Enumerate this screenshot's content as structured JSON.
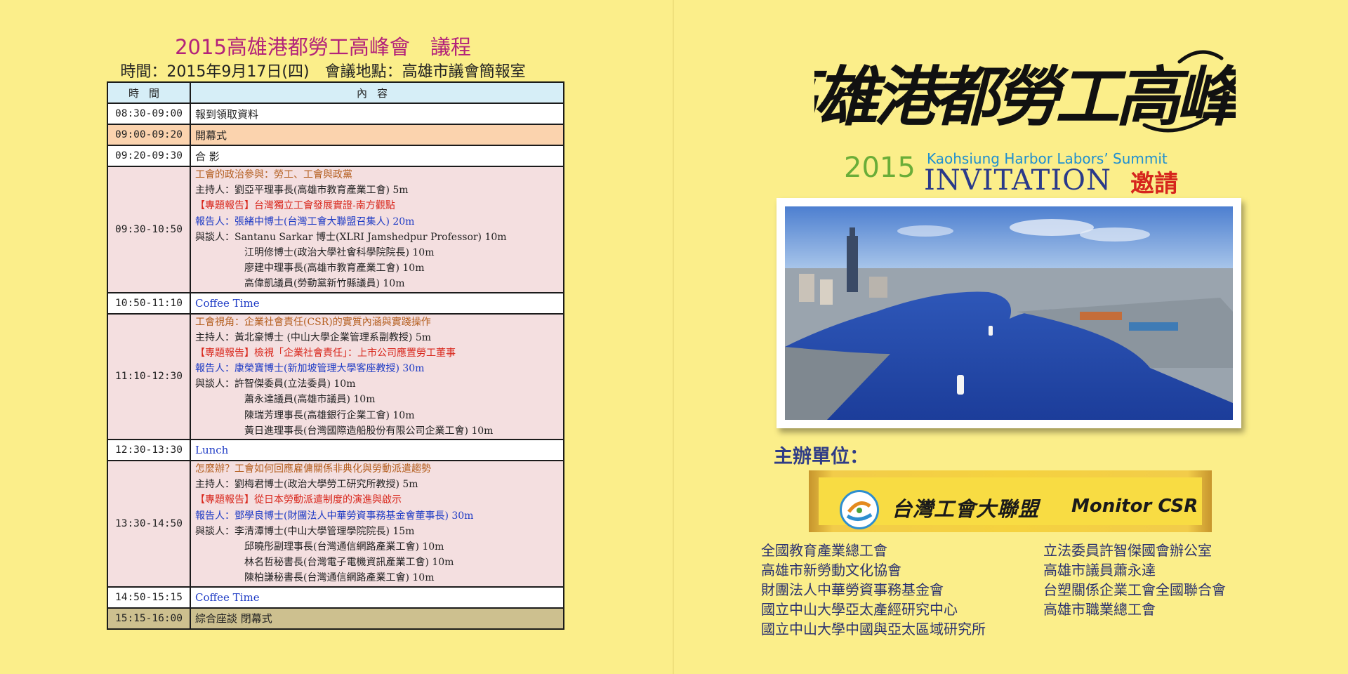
{
  "agenda": {
    "title": "2015高雄港都勞工高峰會　議程",
    "subtitle": "時間：2015年9月17日(四)　會議地點：高雄市議會簡報室",
    "header_time": "時間",
    "header_content": "內容",
    "rows": [
      {
        "time": "08:30-09:00",
        "lines": [
          "報到領取資料"
        ]
      },
      {
        "time": "09:00-09:20",
        "lines": [
          "開幕式"
        ]
      },
      {
        "time": "09:20-09:30",
        "lines": [
          "合 影"
        ]
      },
      {
        "time": "09:30-10:50",
        "lines": [
          "工會的政治參與：勞工、工會與政黨",
          "主持人：劉亞平理事長(高雄市教育產業工會) 5m",
          "【專題報告】台灣獨立工會發展實證-南方觀點",
          "報告人：張緒中博士(台灣工會大聯盟召集人) 20m",
          "與談人：Santanu Sarkar 博士(XLRI Jamshedpur Professor) 10m",
          "江明修博士(政治大學社會科學院院長) 10m",
          "廖建中理事長(高雄市教育產業工會) 10m",
          "高偉凱議員(勞動黨新竹縣議員) 10m"
        ]
      },
      {
        "time": "10:50-11:10",
        "lines": [
          "Coffee Time"
        ]
      },
      {
        "time": "11:10-12:30",
        "lines": [
          "工會視角：企業社會責任(CSR)的實質內涵與實踐操作",
          "主持人：黃北豪博士 (中山大學企業管理系副教授) 5m",
          "【專題報告】檢視「企業社會責任」：上市公司應置勞工董事",
          "報告人：康榮寶博士(新加坡管理大學客座教授) 30m",
          "與談人：許智傑委員(立法委員) 10m",
          "蕭永達議員(高雄市議員) 10m",
          "陳瑞芳理事長(高雄銀行企業工會) 10m",
          "黃日進理事長(台灣國際造船股份有限公司企業工會) 10m"
        ]
      },
      {
        "time": "12:30-13:30",
        "lines": [
          "Lunch"
        ]
      },
      {
        "time": "13:30-14:50",
        "lines": [
          "怎麼辦？工會如何回應雇傭關係非典化與勞動派遣趨勢",
          "主持人：劉梅君博士(政治大學勞工研究所教授) 5m",
          "【專題報告】從日本勞動派遣制度的演進與啟示",
          "報告人：鄧學良博士(財團法人中華勞資事務基金會董事長) 30m",
          "與談人：李清潭博士(中山大學管理學院院長) 15m",
          "邱曉彤副理事長(台灣通信網路產業工會) 10m",
          "林名哲秘書長(台灣電子電機資訊產業工會) 10m",
          "陳柏謙秘書長(台灣通信網路產業工會) 10m"
        ]
      },
      {
        "time": "14:50-15:15",
        "lines": [
          "Coffee Time"
        ]
      },
      {
        "time": "15:15-16:00",
        "lines": [
          "綜合座談 閉幕式"
        ]
      }
    ]
  },
  "cover": {
    "calligraphy_title": "高雄港都勞工高峰會",
    "year": "2015",
    "english_subtitle": "Kaohsiung Harbor Labors’ Summit",
    "invitation": "INVITATION",
    "invitation_zh": "邀請",
    "host_label": "主辦單位：",
    "host_logo_zh": "台灣工會大聯盟",
    "host_logo_en": "Monitor CSR",
    "co_orgs_left": [
      "全國教育產業總工會",
      "高雄市新勞動文化協會",
      "財團法人中華勞資事務基金會",
      "國立中山大學亞太產經研究中心",
      "國立中山大學中國與亞太區域研究所"
    ],
    "co_orgs_right": [
      "立法委員許智傑國會辦公室",
      "高雄市議員蕭永達",
      "台塑關係企業工會全國聯合會",
      "高雄市職業總工會"
    ]
  },
  "colors": {
    "background": "#fbee8a",
    "title_magenta": "#b3227a",
    "topic_brown": "#b45f20",
    "report_red": "#d8261b",
    "speaker_blue": "#1e3bc5",
    "year_green": "#6aad38",
    "invitation_navy": "#2a3a8a"
  }
}
